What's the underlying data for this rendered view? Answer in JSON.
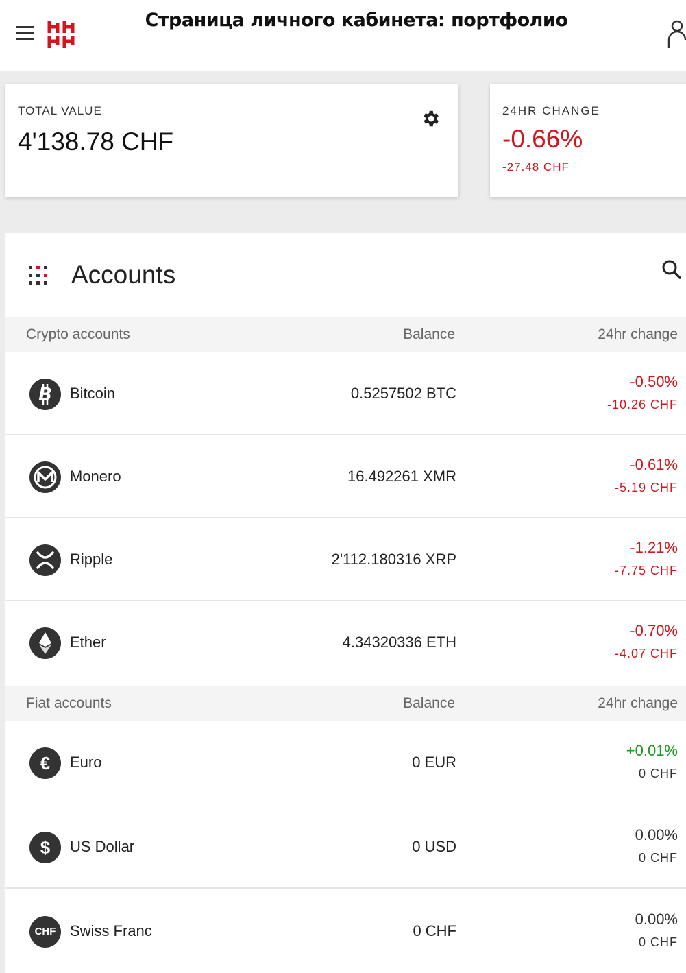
{
  "header": {
    "title": "Страница личного кабинета: портфолио",
    "menu_icon": "hamburger-icon",
    "logo_icon": "brand-logo",
    "user_icon": "user-icon"
  },
  "summary": {
    "total_label": "TOTAL VALUE",
    "total_value": "4'138.78 CHF",
    "settings_icon": "gear-icon",
    "change_label": "24HR CHANGE",
    "change_percent": "-0.66%",
    "change_chf": "-27.48 CHF"
  },
  "accounts": {
    "title": "Accounts",
    "grid_icon": "apps-grid-icon",
    "search_icon": "search-icon",
    "crypto_header": {
      "name": "Crypto accounts",
      "balance": "Balance",
      "change": "24hr change"
    },
    "crypto": [
      {
        "name": "Bitcoin",
        "balance": "0.5257502 BTC",
        "percent": "-0.50%",
        "chf": "-10.26 CHF",
        "icon": "bitcoin-icon"
      },
      {
        "name": "Monero",
        "balance": "16.492261 XMR",
        "percent": "-0.61%",
        "chf": "-5.19 CHF",
        "icon": "monero-icon"
      },
      {
        "name": "Ripple",
        "balance": "2'112.180316 XRP",
        "percent": "-1.21%",
        "chf": "-7.75 CHF",
        "icon": "ripple-icon"
      },
      {
        "name": "Ether",
        "balance": "4.34320336 ETH",
        "percent": "-0.70%",
        "chf": "-4.07 CHF",
        "icon": "ether-icon"
      }
    ],
    "fiat_header": {
      "name": "Fiat accounts",
      "balance": "Balance",
      "change": "24hr change"
    },
    "fiat": [
      {
        "name": "Euro",
        "balance": "0 EUR",
        "percent": "+0.01%",
        "chf": "0 CHF",
        "icon": "euro-icon",
        "symbol": "€"
      },
      {
        "name": "US Dollar",
        "balance": "0 USD",
        "percent": "0.00%",
        "chf": "0 CHF",
        "icon": "dollar-icon",
        "symbol": "$"
      },
      {
        "name": "Swiss Franc",
        "balance": "0 CHF",
        "percent": "0.00%",
        "chf": "0 CHF",
        "icon": "chf-icon",
        "symbol": "CHF"
      }
    ]
  },
  "colors": {
    "negative": "#d0171e",
    "positive": "#1e9a1e",
    "brand": "#d0171e"
  }
}
